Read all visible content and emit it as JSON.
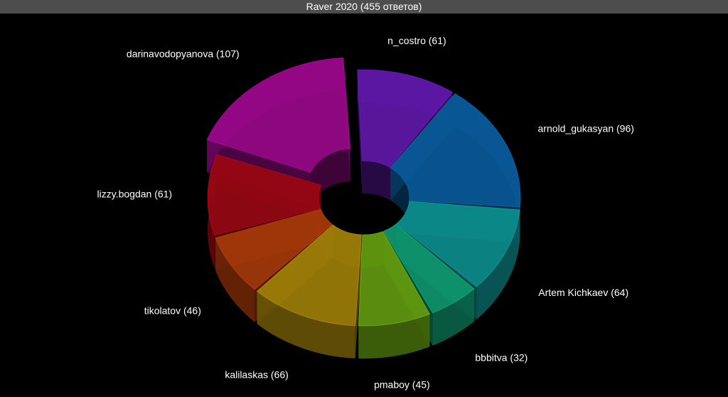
{
  "title": "Raver 2020 (455 ответов)",
  "chart_data": {
    "type": "pie",
    "title": "Raver 2020 (455 ответов)",
    "total": 455,
    "slices": [
      {
        "name": "n_costro",
        "value": 61,
        "label": "n_costro (61)",
        "color": "#7a1fd6"
      },
      {
        "name": "arnold_gukasyan",
        "value": 96,
        "label": "arnold_gukasyan (96)",
        "color": "#0b73c4"
      },
      {
        "name": "Artem Kichkaev",
        "value": 64,
        "label": "Artem Kichkaev (64)",
        "color": "#11b3b3"
      },
      {
        "name": "bbbitva",
        "value": 32,
        "label": "bbbitva (32)",
        "color": "#13bf8e"
      },
      {
        "name": "pmaboy",
        "value": 45,
        "label": "pmaboy (45)",
        "color": "#7dc414"
      },
      {
        "name": "kalilaskas",
        "value": 66,
        "label": "kalilaskas (66)",
        "color": "#c9a20c"
      },
      {
        "name": "tikolatov",
        "value": 46,
        "label": "tikolatov (46)",
        "color": "#d3480d"
      },
      {
        "name": "lizzy.bogdan",
        "value": 61,
        "label": "lizzy.bogdan (61)",
        "color": "#c20a17"
      },
      {
        "name": "darinavodopyanova",
        "value": 107,
        "label": "darinavodopyanova (107)",
        "color": "#c40ab0"
      }
    ]
  }
}
